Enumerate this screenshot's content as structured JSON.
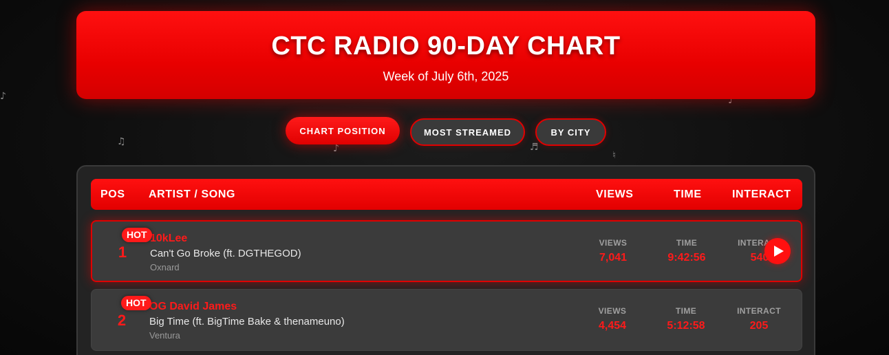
{
  "header": {
    "title": "CTC RADIO 90-DAY CHART",
    "subtitle": "Week of July 6th, 2025"
  },
  "tabs": [
    {
      "label": "CHART POSITION",
      "active": true
    },
    {
      "label": "MOST STREAMED",
      "active": false
    },
    {
      "label": "BY CITY",
      "active": false
    }
  ],
  "table": {
    "columns": {
      "pos": "POS",
      "artist": "ARTIST / SONG",
      "views": "VIEWS",
      "time": "TIME",
      "interact": "INTERACT"
    },
    "rows": [
      {
        "position": "1",
        "badge": "HOT",
        "artist": "10kLee",
        "song": "Can't Go Broke (ft. DGTHEGOD)",
        "city": "Oxnard",
        "views_label": "VIEWS",
        "views": "7,041",
        "time_label": "TIME",
        "time": "9:42:56",
        "interact_label": "INTERACT",
        "interact": "540"
      },
      {
        "position": "2",
        "badge": "HOT",
        "artist": "OG David James",
        "song": "Big Time (ft. BigTime Bake & thenameuno)",
        "city": "Ventura",
        "views_label": "VIEWS",
        "views": "4,454",
        "time_label": "TIME",
        "time": "5:12:58",
        "interact_label": "INTERACT",
        "interact": "205"
      }
    ]
  },
  "icons": {
    "play": "play-icon",
    "notes": [
      "music-note-icon",
      "eighth-notes-icon",
      "sharp-note-icon",
      "natural-sign-icon"
    ]
  },
  "colors": {
    "accent": "#ff1010",
    "background": "#111111",
    "row_bg": "#3b3b3b"
  }
}
